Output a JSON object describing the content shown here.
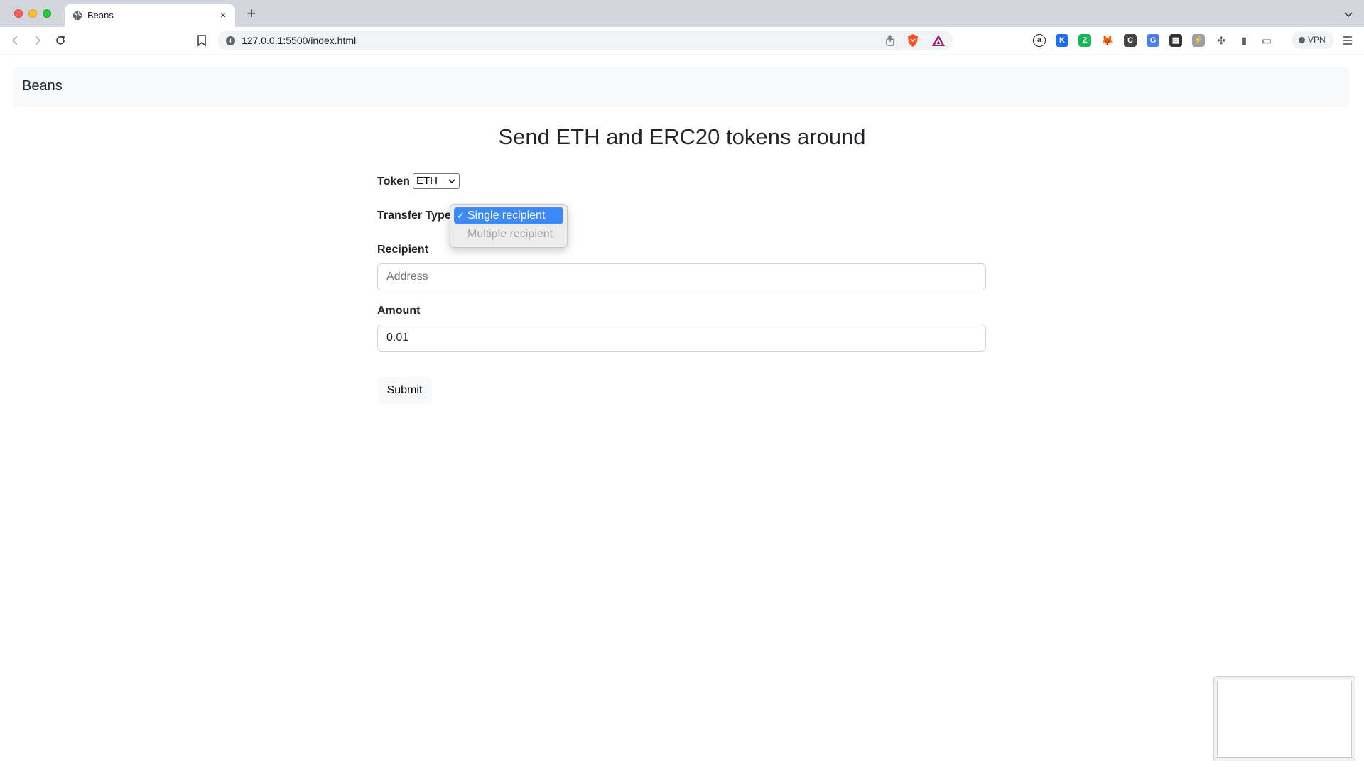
{
  "browser": {
    "tab": {
      "title": "Beans",
      "favicon": "globe-icon",
      "close_glyph": "×"
    },
    "new_tab_glyph": "+",
    "url": "127.0.0.1:5500/index.html",
    "vpn_label": "VPN",
    "extensions": [
      {
        "name": "a-extension-icon",
        "glyph": "a",
        "color": "#202124"
      },
      {
        "name": "k-extension-icon",
        "glyph": "K",
        "color": "#1e6fe8"
      },
      {
        "name": "green-extension-icon",
        "glyph": "Z",
        "color": "#1bb55a"
      },
      {
        "name": "metamask-fox-icon",
        "glyph": "🦊",
        "color": "#f6851b"
      },
      {
        "name": "c-extension-icon",
        "glyph": "C",
        "color": "#444444"
      },
      {
        "name": "translate-extension-icon",
        "glyph": "G",
        "color": "#4a80e8"
      },
      {
        "name": "grid-extension-icon",
        "glyph": "▦",
        "color": "#333333"
      },
      {
        "name": "grey-extension-icon",
        "glyph": "⚡",
        "color": "#9aa0a6"
      },
      {
        "name": "puzzle-extensions-icon",
        "glyph": "✣",
        "color": "#5f6368"
      },
      {
        "name": "sidebar-toggle-icon",
        "glyph": "▮",
        "color": "#5f6368"
      },
      {
        "name": "wallet-icon",
        "glyph": "▭",
        "color": "#5f6368"
      }
    ]
  },
  "navbar": {
    "brand": "Beans"
  },
  "main": {
    "heading": "Send ETH and ERC20 tokens around",
    "token": {
      "label": "Token",
      "selected": "ETH"
    },
    "transfer_type": {
      "label": "Transfer Type",
      "options": [
        {
          "label": "Single recipient",
          "check": "✓",
          "selected": true
        },
        {
          "label": "Multiple recipient",
          "disabled": true
        }
      ]
    },
    "recipient": {
      "label": "Recipient",
      "placeholder": "Address"
    },
    "amount": {
      "label": "Amount",
      "value": "0.01"
    },
    "submit_label": "Submit"
  }
}
